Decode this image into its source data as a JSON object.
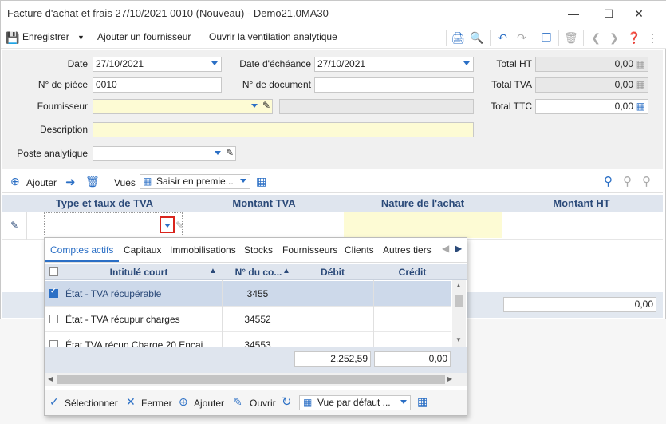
{
  "window": {
    "title": "Facture d'achat et frais 27/10/2021 0010 (Nouveau) - Demo21.0MA30"
  },
  "toolbar": {
    "save": "Enregistrer",
    "add_supplier": "Ajouter un fournisseur",
    "open_analytic": "Ouvrir la ventilation analytique"
  },
  "form": {
    "date_label": "Date",
    "date_value": "27/10/2021",
    "due_label": "Date d'échéance",
    "due_value": "27/10/2021",
    "piece_label": "N° de pièce",
    "piece_value": "0010",
    "doc_label": "N° de document",
    "doc_value": "",
    "supplier_label": "Fournisseur",
    "supplier_value": "",
    "desc_label": "Description",
    "desc_value": "",
    "analytic_label": "Poste analytique",
    "analytic_value": "",
    "total_ht_label": "Total HT",
    "total_ht": "0,00",
    "total_tva_label": "Total TVA",
    "total_tva": "0,00",
    "total_ttc_label": "Total TTC",
    "total_ttc": "0,00"
  },
  "grid": {
    "add": "Ajouter",
    "views_label": "Vues",
    "views_value": "Saisir en premie...",
    "columns": [
      "Type et taux de TVA",
      "Montant TVA",
      "Nature de l'achat",
      "Montant HT"
    ],
    "footer_total": "0,00"
  },
  "popup": {
    "tabs": [
      "Comptes actifs",
      "Capitaux",
      "Immobilisations",
      "Stocks",
      "Fournisseurs",
      "Clients",
      "Autres tiers"
    ],
    "columns": [
      "Intitulé court",
      "N° du co...",
      "Débit",
      "Crédit"
    ],
    "rows": [
      {
        "label": "État - TVA récupérable",
        "num": "3455",
        "checked": true
      },
      {
        "label": "État - TVA récupur charges",
        "num": "34552",
        "checked": false
      },
      {
        "label": "État TVA récup Charge 20 Encai",
        "num": "34553",
        "checked": false
      }
    ],
    "total_debit": "2.252,59",
    "total_credit": "0,00",
    "select": "Sélectionner",
    "close": "Fermer",
    "add": "Ajouter",
    "open": "Ouvrir",
    "view": "Vue par défaut ..."
  },
  "colors": {
    "accent": "#2b6fc5",
    "highlight_red": "#d9241c"
  }
}
